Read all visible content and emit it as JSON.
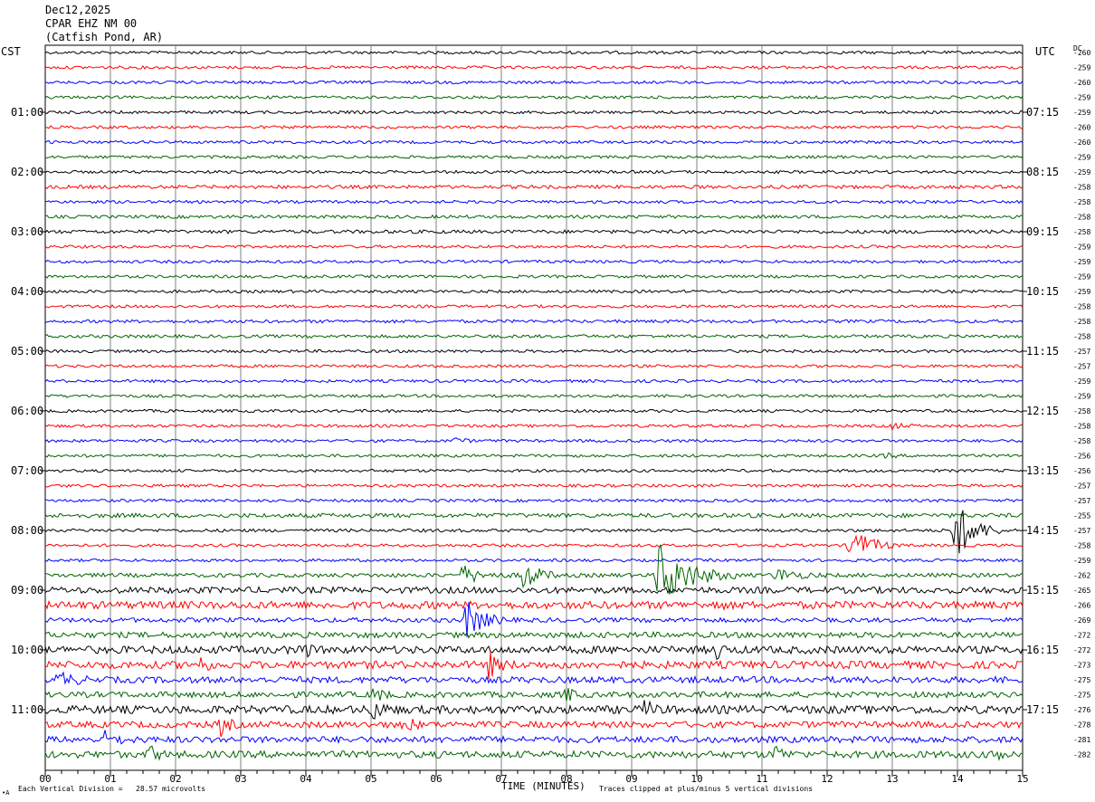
{
  "header": {
    "date": "Dec12,2025",
    "station": "CPAR EHZ NM 00",
    "location": "(Catfish Pond, AR)"
  },
  "axes": {
    "left_tz": "CST",
    "right_tz": "UTC",
    "dc_label": "DC",
    "xlabel": "TIME (MINUTES)",
    "scale_note": "Each Vertical Division =   28.57 microvolts",
    "clip_note": "Traces clipped at plus/minus 5 vertical divisions",
    "corner_mark": "•A"
  },
  "chart_data": {
    "type": "line",
    "title": "",
    "xlabel": "TIME (MINUTES)",
    "ylabel": "",
    "xlim": [
      0,
      15
    ],
    "x_ticks": [
      "00",
      "01",
      "02",
      "03",
      "04",
      "05",
      "06",
      "07",
      "08",
      "09",
      "10",
      "11",
      "12",
      "13",
      "14",
      "15"
    ],
    "grid": true,
    "row_minutes": 15,
    "trace_colors": [
      "#000000",
      "#ff0000",
      "#0000ff",
      "#006400"
    ],
    "left_time_labels": [
      "01:00",
      "02:00",
      "03:00",
      "04:00",
      "05:00",
      "06:00",
      "07:00",
      "08:00",
      "09:00",
      "10:00",
      "11:00"
    ],
    "right_time_labels": [
      "07:15",
      "08:15",
      "09:15",
      "10:15",
      "11:15",
      "12:15",
      "13:15",
      "14:15",
      "15:15",
      "16:15",
      "17:15"
    ],
    "dc_offsets": [
      -260,
      -259,
      -260,
      -259,
      -259,
      -260,
      -260,
      -259,
      -259,
      -258,
      -258,
      -258,
      -258,
      -259,
      -259,
      -259,
      -259,
      -258,
      -258,
      -258,
      -257,
      -257,
      -259,
      -259,
      -258,
      -258,
      -258,
      -256,
      -256,
      -257,
      -257,
      -255,
      -257,
      -258,
      -259,
      -262,
      -265,
      -266,
      -269,
      -272,
      -272,
      -273,
      -275,
      -275,
      -276,
      -278,
      -281,
      -282
    ],
    "trace_amplitude": [
      1.0,
      1.0,
      1.0,
      1.0,
      1.0,
      1.0,
      1.0,
      1.0,
      1.0,
      1.2,
      1.0,
      1.1,
      1.2,
      1.0,
      1.0,
      1.0,
      1.0,
      1.0,
      1.1,
      1.1,
      1.0,
      1.0,
      1.0,
      1.0,
      1.0,
      1.0,
      1.0,
      1.0,
      1.0,
      1.0,
      1.0,
      1.5,
      1.1,
      1.0,
      1.0,
      1.4,
      2.2,
      2.6,
      1.6,
      2.0,
      2.6,
      2.6,
      2.2,
      2.0,
      2.8,
      2.2,
      2.2,
      2.4
    ],
    "events": [
      {
        "row": 25,
        "minute": 13.0,
        "amp": 4,
        "dur": 0.4
      },
      {
        "row": 26,
        "minute": 6.3,
        "amp": 4,
        "dur": 0.3
      },
      {
        "row": 27,
        "minute": 12.9,
        "amp": 3,
        "dur": 0.3
      },
      {
        "row": 32,
        "minute": 13.95,
        "amp": 36,
        "dur": 0.8
      },
      {
        "row": 33,
        "minute": 12.35,
        "amp": 22,
        "dur": 0.8
      },
      {
        "row": 35,
        "minute": 6.4,
        "amp": 10,
        "dur": 0.8
      },
      {
        "row": 35,
        "minute": 7.3,
        "amp": 22,
        "dur": 0.6
      },
      {
        "row": 35,
        "minute": 9.4,
        "amp": 38,
        "dur": 1.2
      },
      {
        "row": 35,
        "minute": 11.2,
        "amp": 8,
        "dur": 0.8
      },
      {
        "row": 37,
        "minute": 10.3,
        "amp": 5,
        "dur": 0.2
      },
      {
        "row": 38,
        "minute": 6.45,
        "amp": 22,
        "dur": 0.7
      },
      {
        "row": 40,
        "minute": 3.9,
        "amp": 14,
        "dur": 0.3
      },
      {
        "row": 40,
        "minute": 10.3,
        "amp": 12,
        "dur": 0.2
      },
      {
        "row": 41,
        "minute": 6.8,
        "amp": 14,
        "dur": 0.4
      },
      {
        "row": 41,
        "minute": 2.4,
        "amp": 10,
        "dur": 0.2
      },
      {
        "row": 42,
        "minute": 0.2,
        "amp": 8,
        "dur": 0.6
      },
      {
        "row": 43,
        "minute": 5.05,
        "amp": 10,
        "dur": 0.3
      },
      {
        "row": 43,
        "minute": 8.0,
        "amp": 8,
        "dur": 0.3
      },
      {
        "row": 44,
        "minute": 5.0,
        "amp": 12,
        "dur": 0.4
      },
      {
        "row": 44,
        "minute": 9.2,
        "amp": 10,
        "dur": 0.3
      },
      {
        "row": 45,
        "minute": 2.7,
        "amp": 12,
        "dur": 0.3
      },
      {
        "row": 45,
        "minute": 5.5,
        "amp": 12,
        "dur": 0.3
      },
      {
        "row": 46,
        "minute": 0.9,
        "amp": 8,
        "dur": 0.5
      },
      {
        "row": 47,
        "minute": 1.6,
        "amp": 10,
        "dur": 0.3
      },
      {
        "row": 47,
        "minute": 11.2,
        "amp": 10,
        "dur": 0.3
      },
      {
        "row": 47,
        "minute": 14.6,
        "amp": 10,
        "dur": 0.3
      },
      {
        "row": 48,
        "minute": 4.6,
        "amp": 12,
        "dur": 0.3
      },
      {
        "row": 48,
        "minute": 7.2,
        "amp": 10,
        "dur": 0.3
      },
      {
        "row": 49,
        "minute": 7.8,
        "amp": 8,
        "dur": 0.3
      },
      {
        "row": 50,
        "minute": 7.75,
        "amp": 14,
        "dur": 0.4
      },
      {
        "row": 50,
        "minute": 5.2,
        "amp": 8,
        "dur": 0.3
      }
    ]
  }
}
